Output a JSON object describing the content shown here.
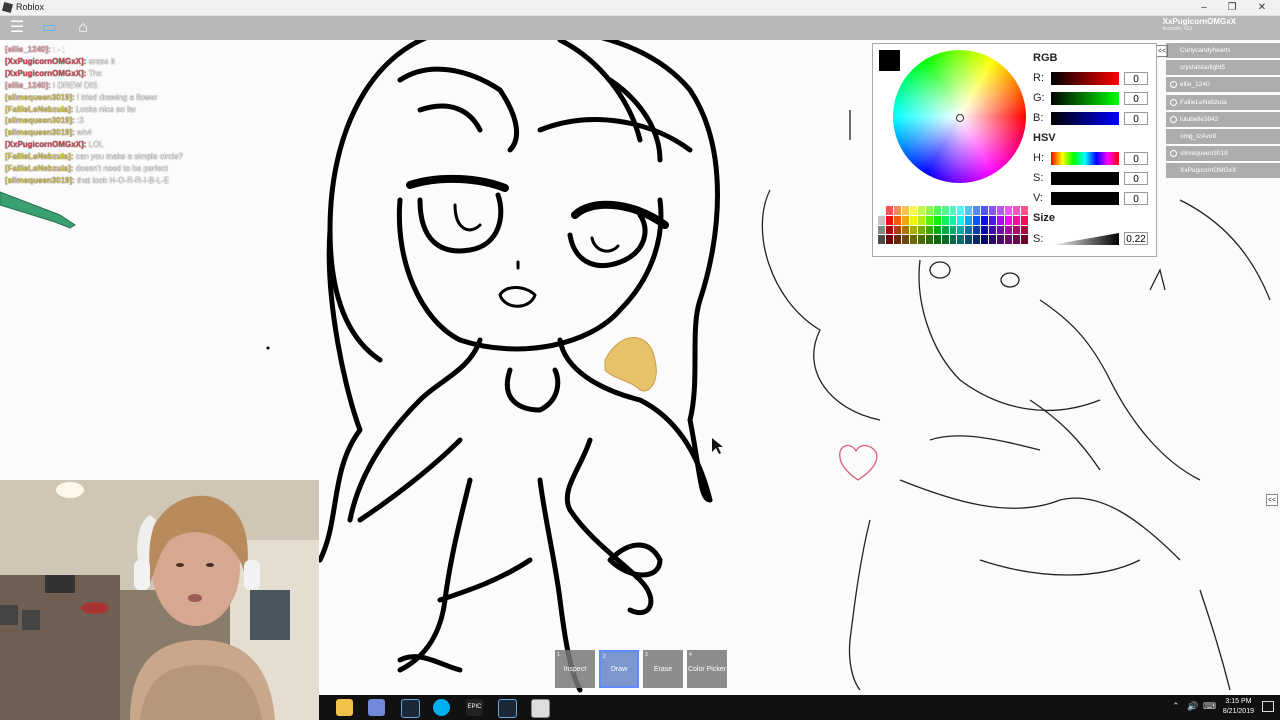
{
  "window": {
    "title": "Roblox",
    "minimize": "–",
    "maximize": "❐",
    "close": "✕"
  },
  "topbar": {
    "menu_icon": "menu-icon",
    "chat_icon": "chat-bubble-icon",
    "backpack_icon": "backpack-icon",
    "menu_glyph": "☰",
    "chat_glyph": "▭",
    "backpack_glyph": "⌂"
  },
  "account": {
    "name": "XxPugicornOMGxX",
    "sub": "Account: <13"
  },
  "chat": [
    {
      "who": "[ellie_1240]:",
      "msg": ": - ;",
      "color": "#e8a0a8"
    },
    {
      "who": "[XxPugicornOMGxX]:",
      "msg": "erase it",
      "color": "#d24a56"
    },
    {
      "who": "[XxPugicornOMGxX]:",
      "msg": "Thx",
      "color": "#d24a56"
    },
    {
      "who": "[ellie_1240]:",
      "msg": "I DREW DIS",
      "color": "#e8a0a8"
    },
    {
      "who": "[slimequeen3019]:",
      "msg": "I tried drawing a flower",
      "color": "#d9c35a"
    },
    {
      "who": "[FallieLeNebzula]:",
      "msg": "Looks nice so far",
      "color": "#d9c35a"
    },
    {
      "who": "[slimequeen3019]:",
      "msg": ":3",
      "color": "#d9c35a"
    },
    {
      "who": "[slimequeen3019]:",
      "msg": "wh4",
      "color": "#d9c35a"
    },
    {
      "who": "[XxPugicornOMGxX]:",
      "msg": "LOL",
      "color": "#d24a56"
    },
    {
      "who": "[FallieLeNebzula]:",
      "msg": "can you make a simple circle?",
      "color": "#d9c35a"
    },
    {
      "who": "[FallieLeNebzula]:",
      "msg": "doesn't need to be perfect",
      "color": "#d9c35a"
    },
    {
      "who": "[slimequeen3019]:",
      "msg": "that look H-O-R-R-I-B-L-E",
      "color": "#d9c35a"
    }
  ],
  "players": [
    {
      "name": "Curlycandyhearts",
      "icon": false
    },
    {
      "name": "crystalstarlight5",
      "icon": false
    },
    {
      "name": "ellie_1240",
      "icon": true
    },
    {
      "name": "FallieLeNebzula",
      "icon": true
    },
    {
      "name": "lulubelle3842",
      "icon": true
    },
    {
      "name": "omg_tzAvu9",
      "icon": false
    },
    {
      "name": "slimequeen3019",
      "icon": true
    },
    {
      "name": "XxPugicornOMGxX",
      "icon": false
    }
  ],
  "playerlist_collapse": "<<",
  "side_collapse": "<<",
  "picker": {
    "rgb_title": "RGB",
    "r_label": "R:",
    "g_label": "G:",
    "b_label": "B:",
    "r_value": "0",
    "g_value": "0",
    "b_value": "0",
    "hsv_title": "HSV",
    "h_label": "H:",
    "s_label": "S:",
    "v_label": "V:",
    "h_value": "0",
    "s_value": "0",
    "v_value": "0",
    "size_title": "Size",
    "size_label": "S:",
    "size_value": "0.22",
    "current_color": "#000000"
  },
  "tools": [
    {
      "num": "1",
      "label": "Inspect",
      "active": false
    },
    {
      "num": "2",
      "label": "Draw",
      "active": true
    },
    {
      "num": "3",
      "label": "Erase",
      "active": false
    },
    {
      "num": "4",
      "label": "Color Picker",
      "active": false
    }
  ],
  "taskbar": {
    "time": "3:15 PM",
    "date": "8/21/2019",
    "apps": [
      "file-explorer-icon",
      "discord-icon",
      "steam-icon",
      "skype-icon",
      "epic-games-icon",
      "steam-icon",
      "roblox-icon"
    ],
    "epic_label": "EPIC",
    "tray_up": "⌃",
    "speaker": "🔊",
    "keyboard": "⌨"
  }
}
